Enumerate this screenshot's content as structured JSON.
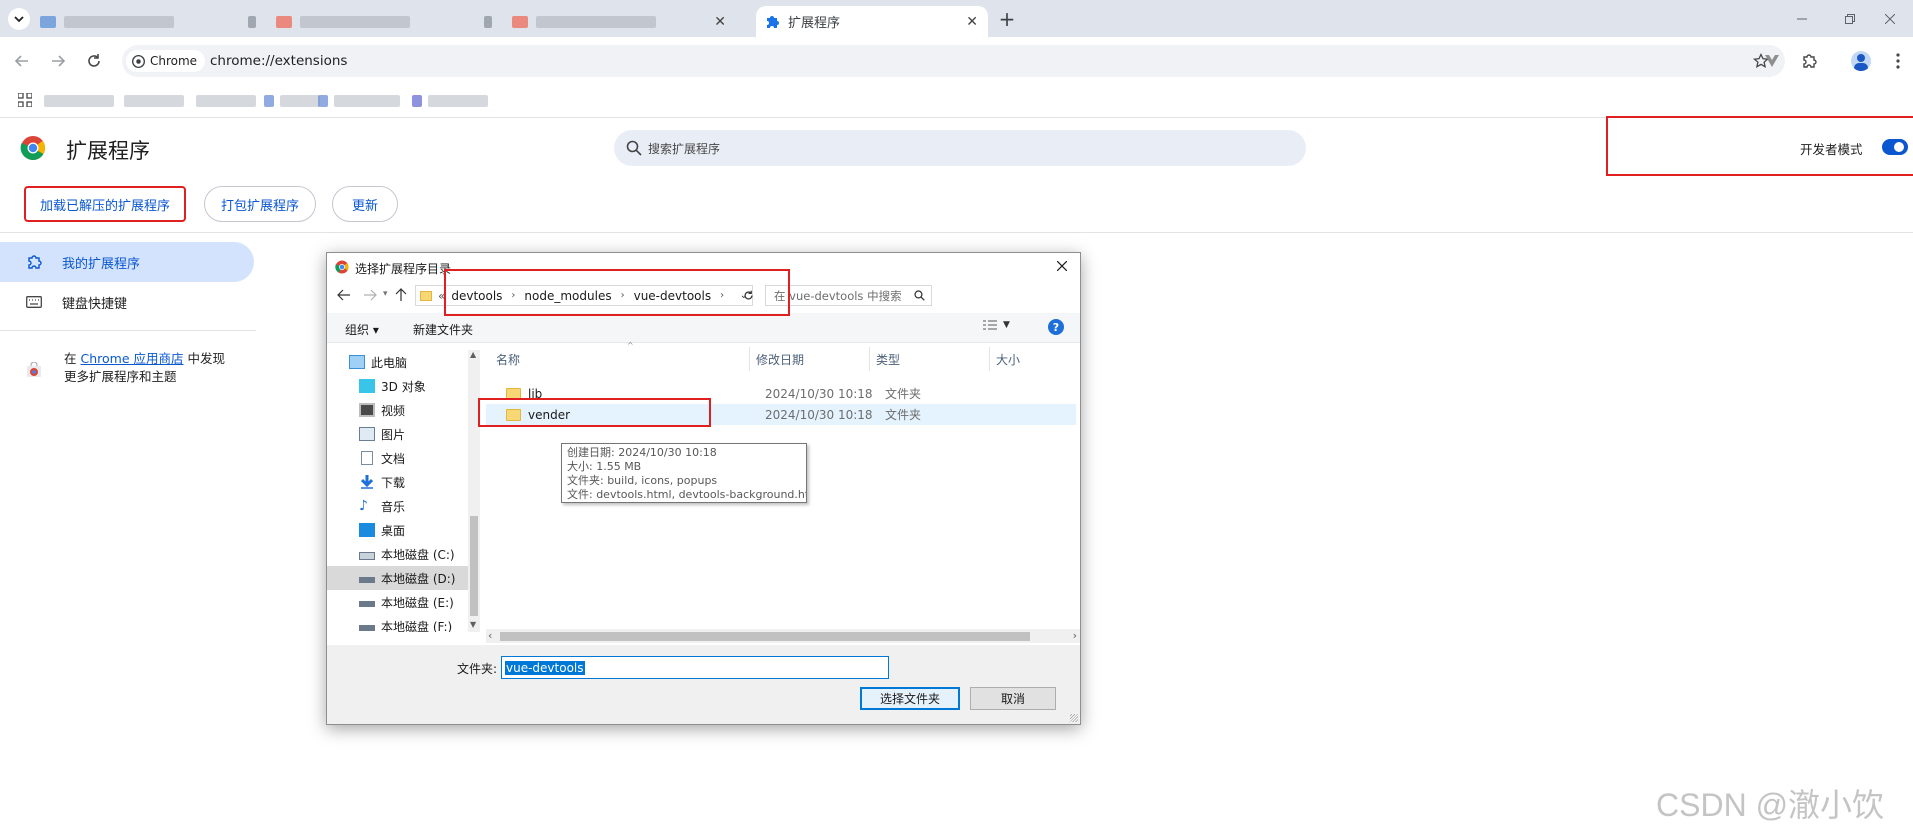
{
  "browser": {
    "tabs": [
      {
        "label": "扩展程序",
        "active": true
      }
    ],
    "new_tab": "+",
    "chip_label": "Chrome",
    "url": "chrome://extensions"
  },
  "page": {
    "title": "扩展程序",
    "search_placeholder": "搜索扩展程序",
    "dev_mode_label": "开发者模式",
    "dev_mode_on": true,
    "buttons": {
      "load_unpacked": "加载已解压的扩展程序",
      "pack": "打包扩展程序",
      "update": "更新"
    },
    "sidebar": {
      "my_extensions": "我的扩展程序",
      "shortcuts": "键盘快捷键",
      "discover_prefix": "在 ",
      "discover_link": "Chrome 应用商店",
      "discover_suffix": " 中发现",
      "discover_line2": "更多扩展程序和主题"
    },
    "accent": "#0b57d0"
  },
  "dialog": {
    "title": "选择扩展程序目录",
    "breadcrumb": {
      "prefix": "«",
      "parts": [
        "devtools",
        "node_modules",
        "vue-devtools"
      ]
    },
    "search_placeholder": "在 vue-devtools 中搜索",
    "toolbar": {
      "organize": "组织 ▾",
      "new_folder": "新建文件夹"
    },
    "nav": [
      {
        "label": "此电脑"
      },
      {
        "label": "3D 对象"
      },
      {
        "label": "视频"
      },
      {
        "label": "图片"
      },
      {
        "label": "文档"
      },
      {
        "label": "下载"
      },
      {
        "label": "音乐"
      },
      {
        "label": "桌面"
      },
      {
        "label": "本地磁盘 (C:)"
      },
      {
        "label": "本地磁盘 (D:)"
      },
      {
        "label": "本地磁盘 (E:)"
      },
      {
        "label": "本地磁盘 (F:)"
      }
    ],
    "columns": {
      "name": "名称",
      "modified": "修改日期",
      "type": "类型",
      "size": "大小"
    },
    "files": [
      {
        "name": "lib",
        "modified": "2024/10/30 10:18",
        "type": "文件夹"
      },
      {
        "name": "vender",
        "modified": "2024/10/30 10:18",
        "type": "文件夹"
      }
    ],
    "tooltip": {
      "line1": "创建日期: 2024/10/30 10:18",
      "line2": "大小: 1.55 MB",
      "line3": "文件夹: build, icons, popups",
      "line4": "文件: devtools.html, devtools-background.html, ..."
    },
    "folder_label": "文件夹:",
    "folder_value": "vue-devtools",
    "select_button": "选择文件夹",
    "cancel_button": "取消"
  },
  "watermark": "CSDN @澈小饮"
}
